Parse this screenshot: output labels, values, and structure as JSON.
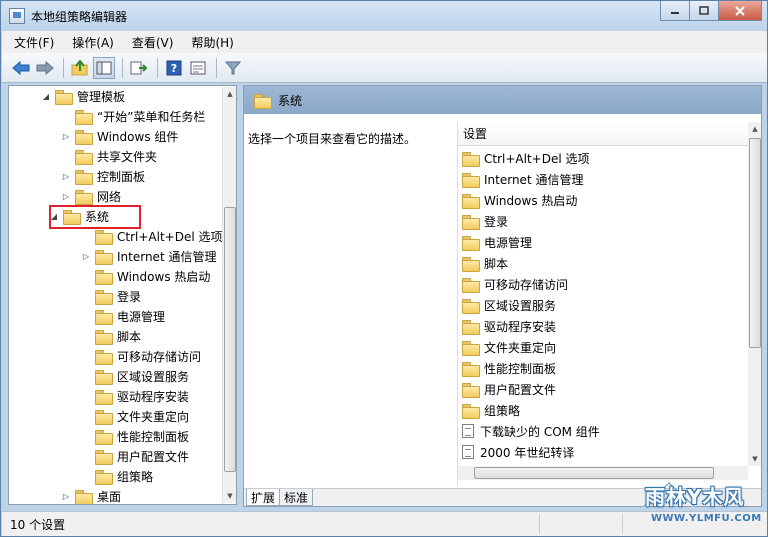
{
  "window": {
    "title": "本地组策略编辑器",
    "minimize": "▭",
    "maximize": "☐",
    "close": "✕"
  },
  "menu": [
    "文件(F)",
    "操作(A)",
    "查看(V)",
    "帮助(H)"
  ],
  "toolbar_icons": [
    "back-arrow-icon",
    "forward-arrow-icon",
    "up-folder-icon",
    "show-tree-icon",
    "export-list-icon",
    "help-icon",
    "properties-icon",
    "filter-icon"
  ],
  "tree": {
    "items": [
      {
        "label": "管理模板",
        "expander": "◢"
      },
      {
        "label": "“开始”菜单和任务栏",
        "expander": ""
      },
      {
        "label": "Windows 组件",
        "expander": "▷"
      },
      {
        "label": "共享文件夹",
        "expander": ""
      },
      {
        "label": "控制面板",
        "expander": "▷"
      },
      {
        "label": "网络",
        "expander": "▷"
      },
      {
        "label": "系统",
        "expander": "◢"
      },
      {
        "label": "Ctrl+Alt+Del 选项",
        "expander": ""
      },
      {
        "label": "Internet 通信管理",
        "expander": "▷"
      },
      {
        "label": "Windows 热启动",
        "expander": ""
      },
      {
        "label": "登录",
        "expander": ""
      },
      {
        "label": "电源管理",
        "expander": ""
      },
      {
        "label": "脚本",
        "expander": ""
      },
      {
        "label": "可移动存储访问",
        "expander": ""
      },
      {
        "label": "区域设置服务",
        "expander": ""
      },
      {
        "label": "驱动程序安装",
        "expander": ""
      },
      {
        "label": "文件夹重定向",
        "expander": ""
      },
      {
        "label": "性能控制面板",
        "expander": ""
      },
      {
        "label": "用户配置文件",
        "expander": ""
      },
      {
        "label": "组策略",
        "expander": ""
      },
      {
        "label": "桌面",
        "expander": "▷"
      }
    ]
  },
  "right": {
    "header": "系统",
    "description": "选择一个项目来查看它的描述。",
    "list_header": "设置",
    "items": [
      {
        "label": "Ctrl+Alt+Del 选项",
        "icon": "folder"
      },
      {
        "label": "Internet 通信管理",
        "icon": "folder"
      },
      {
        "label": "Windows 热启动",
        "icon": "folder"
      },
      {
        "label": "登录",
        "icon": "folder"
      },
      {
        "label": "电源管理",
        "icon": "folder"
      },
      {
        "label": "脚本",
        "icon": "folder"
      },
      {
        "label": "可移动存储访问",
        "icon": "folder"
      },
      {
        "label": "区域设置服务",
        "icon": "folder"
      },
      {
        "label": "驱动程序安装",
        "icon": "folder"
      },
      {
        "label": "文件夹重定向",
        "icon": "folder"
      },
      {
        "label": "性能控制面板",
        "icon": "folder"
      },
      {
        "label": "用户配置文件",
        "icon": "folder"
      },
      {
        "label": "组策略",
        "icon": "folder"
      },
      {
        "label": "下载缺少的 COM 组件",
        "icon": "setting"
      },
      {
        "label": "2000 年世纪转译",
        "icon": "setting"
      }
    ],
    "tabs": [
      "扩展",
      "标准"
    ]
  },
  "status": {
    "text": "10 个设置"
  },
  "watermark": {
    "main": "雨林Y木风",
    "url": "WWW.YLMFU.COM"
  }
}
